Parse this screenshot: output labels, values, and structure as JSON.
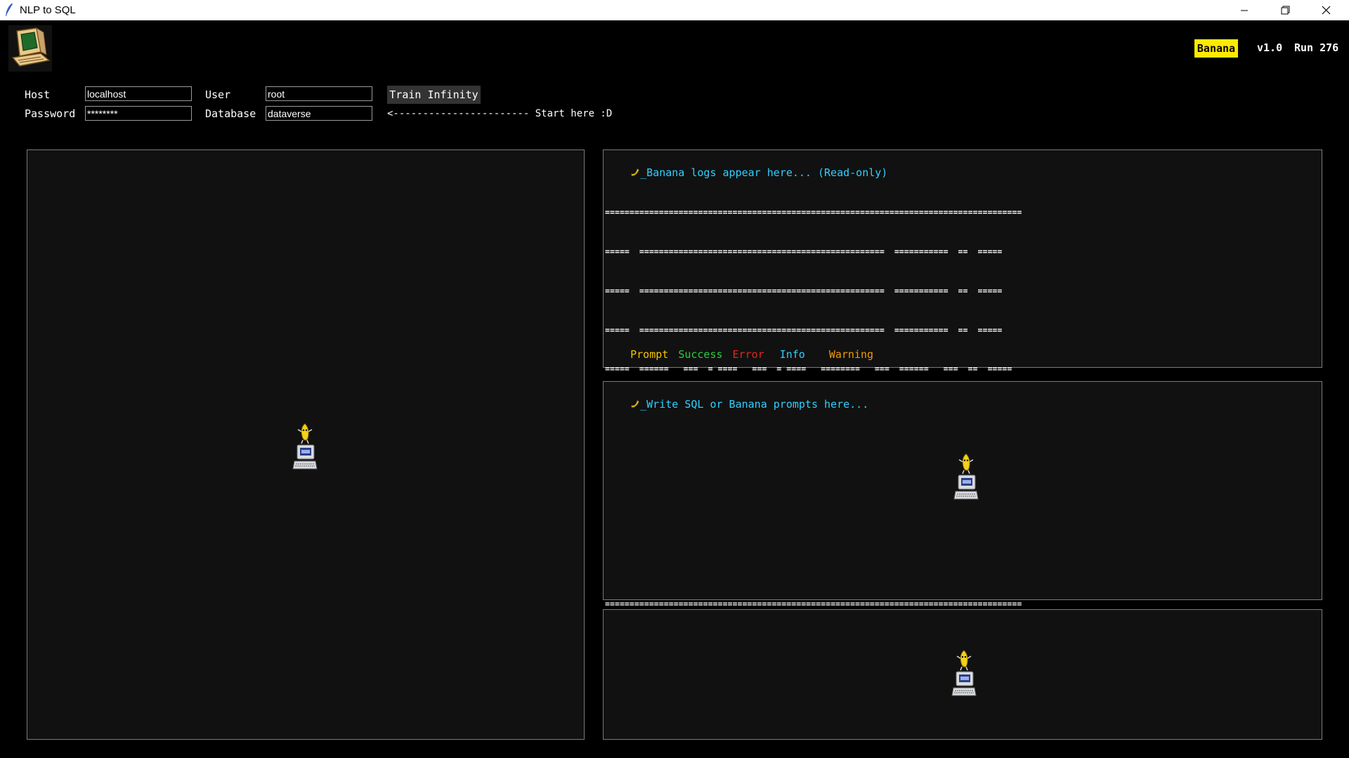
{
  "window": {
    "title": "NLP to SQL",
    "controls": [
      "minimize",
      "restore",
      "close"
    ]
  },
  "header": {
    "badge": "Banana",
    "version": "v1.0",
    "run": "Run 276",
    "accent_color": "#ffea00"
  },
  "connection": {
    "host_label": "Host",
    "host_value": "localhost",
    "password_label": "Password",
    "password_value": "********",
    "user_label": "User",
    "user_value": "root",
    "database_label": "Database",
    "database_value": "dataverse",
    "train_button": "Train Infinity",
    "start_hint": "<----------------------- Start here :D"
  },
  "logs": {
    "placeholder": "_Banana logs appear here... (Read-only)",
    "ascii_art": [
      "=====================================================================================",
      "=====  ==================================================  ===========  ==  =====",
      "=====  ==================================================  ===========  ==  =====",
      "=====  ==================================================  ===========  ==  =====",
      "=====  ======   ===  = ====   ===  = ====   ========   ===  ======   ===  ==  =====",
      "=====    ===  =  ==     ==  =  ==     ==  =  =======  =  ==    ===  =  ==  ==  =====",
      "=====  =  =====  ==  =  =====  ==  =  =====  =======  ====  =  ==     ==  ==  =====",
      "=====  =  ===    ==  =  ===    ==  =  ===    ========  ===  =  ==  =====  ==  =====",
      "=====  =  ==  =  ==  =  ==  =  ==  =  ==  =  =======  =  ==  =  ==  =  ==  ==  =====",
      "=====    ====    ==  =  ===    ==  =  ===    =======   ===  =  ===   ===  ==  =====",
      "====================================================================================="
    ],
    "legend": {
      "prompt": "Prompt",
      "success": "Success",
      "error": "Error",
      "info": "Info",
      "warning": "Warning"
    },
    "legend_colors": {
      "prompt": "#f5c400",
      "success": "#2ecc40",
      "error": "#e5261f",
      "info": "#2fd0ff",
      "warning": "#f59a00"
    }
  },
  "prompt": {
    "placeholder": "_Write SQL or Banana prompts here..."
  },
  "icons": {
    "app": "feather-icon",
    "logo": "computer-logo-icon",
    "mascot": "banana-computer-mascot-icon",
    "banana": "banana-icon"
  }
}
